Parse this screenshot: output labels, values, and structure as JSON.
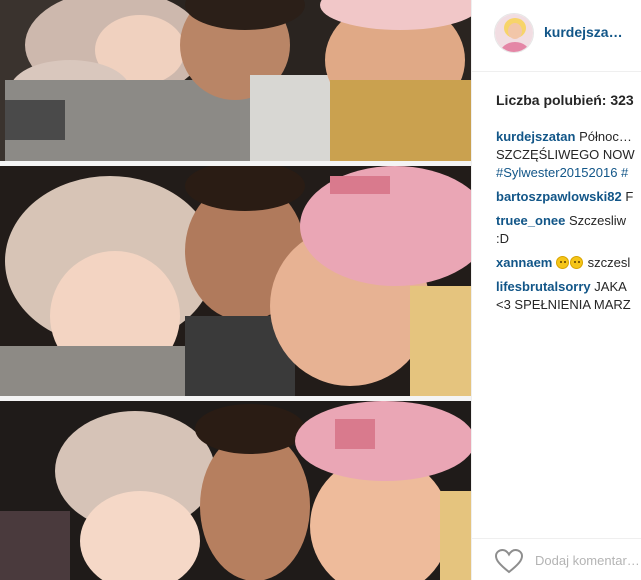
{
  "post": {
    "username": "kurdejsza…",
    "likes_label": "Liczba polubień: 323"
  },
  "comments": [
    {
      "user": "kurdejszatan",
      "lines": [
        "Północ…",
        "SZCZĘŚLIWEGO NOW"
      ],
      "tags_line": "#Sylwester20152016 #"
    },
    {
      "user": "bartoszpawlowski82",
      "text": "F"
    },
    {
      "user": "truee_onee",
      "text": "Szczesliw",
      "text2": ":D"
    },
    {
      "user": "xannaem",
      "text": "szczesl"
    },
    {
      "user": "lifesbrutalsorry",
      "text": "JAKA",
      "text2": "<3 SPEŁNIENIA MARZ"
    }
  ],
  "footer": {
    "add_comment_placeholder": "Dodaj komentar…"
  },
  "colors": {
    "username_link": "#125688",
    "text": "#262626",
    "placeholder": "#b4b4b4",
    "hat_pink": "#e9a7b6",
    "hat_cream": "#e8d6c8"
  },
  "icons": {
    "like": "heart-outline-icon"
  }
}
